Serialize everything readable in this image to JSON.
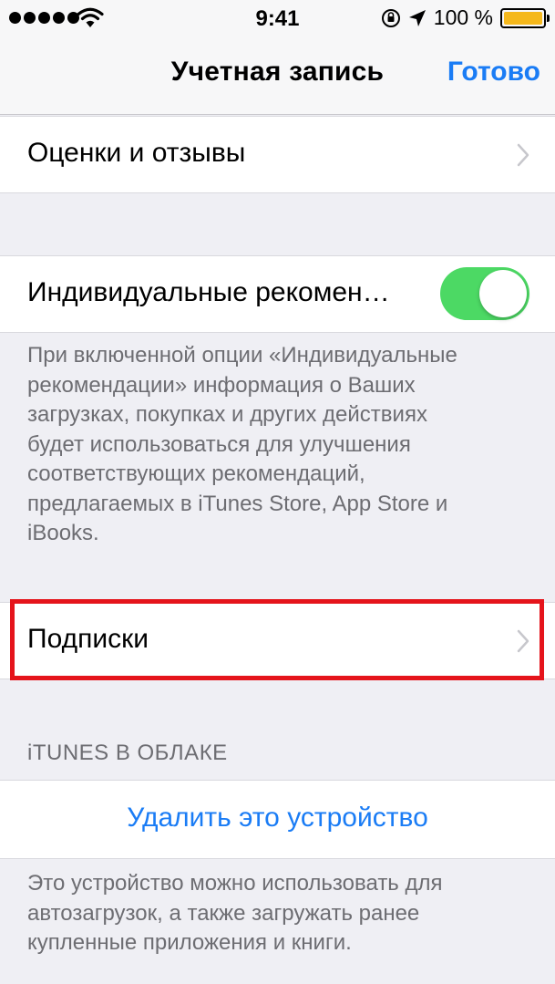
{
  "status_bar": {
    "time": "9:41",
    "battery_percent": "100 %",
    "signal_bars": 5
  },
  "nav": {
    "title": "Учетная запись",
    "done_label": "Готово"
  },
  "rows": {
    "ratings": {
      "label": "Оценки и отзывы"
    },
    "recommendations": {
      "label": "Индивидуальные рекомен…",
      "toggle_on": true,
      "footer_lines": [
        "При включенной опции «Индивидуальные",
        "рекомендации» информация о Ваших",
        "загрузках, покупках и других действиях",
        "будет использоваться для улучшения",
        "соответствующих рекомендаций,",
        "предлагаемых в iTunes Store, App Store и",
        "iBooks."
      ]
    },
    "subscriptions": {
      "label": "Подписки"
    }
  },
  "cloud_section": {
    "header": "iTUNES В ОБЛАКЕ",
    "remove_device_label": "Удалить это устройство",
    "footer_lines": [
      "Это устройство можно использовать для",
      "автозагрузок, а также загружать ранее",
      "купленные приложения и книги."
    ]
  },
  "colors": {
    "accent": "#1a7cf5",
    "toggle_on": "#4cd964",
    "highlight": "#e5141b",
    "battery": "#f5b81c",
    "background": "#efeff4"
  },
  "icons": {
    "wifi": "wifi-icon",
    "rotation_lock": "rotation-lock-icon",
    "location": "location-arrow-icon",
    "battery": "battery-icon",
    "chevron": "chevron-right-icon"
  }
}
